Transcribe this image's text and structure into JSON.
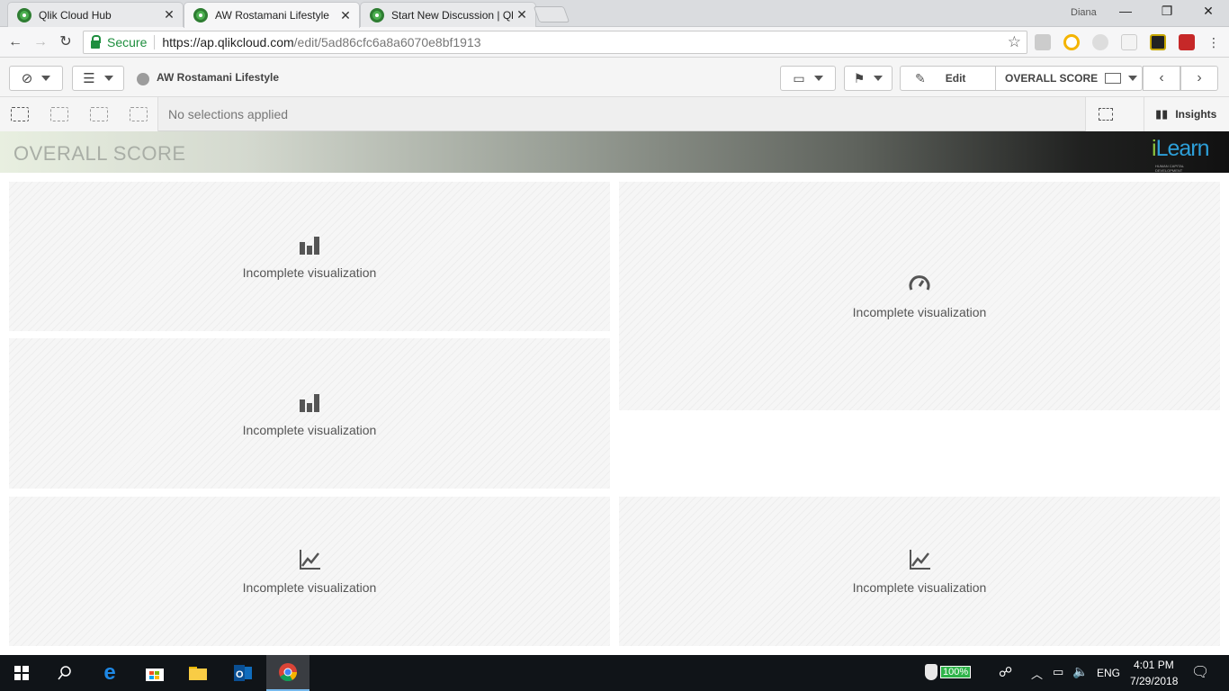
{
  "browser": {
    "tabs": [
      {
        "title": "Qlik Cloud Hub",
        "active": false
      },
      {
        "title": "AW Rostamani Lifestyle",
        "active": true
      },
      {
        "title": "Start New Discussion | Ql",
        "active": false
      }
    ],
    "user": "Diana",
    "secure_label": "Secure",
    "url_host": "https://ap.qlikcloud.com",
    "url_path": "/edit/5ad86cfc6a8a6070e8bf1913"
  },
  "toolbar": {
    "app_name": "AW Rostamani Lifestyle",
    "edit_label": "Edit",
    "sheet_name": "OVERALL SCORE"
  },
  "selections": {
    "status": "No selections applied",
    "insights_label": "Insights"
  },
  "sheet": {
    "title": "OVERALL SCORE",
    "logo_text": "Learn",
    "logo_prefix": "i",
    "logo_subtitle": "HUMAN CAPITAL DEVELOPMENT"
  },
  "tiles": [
    {
      "icon": "bar-chart-icon",
      "label": "Incomplete visualization"
    },
    {
      "icon": "gauge-icon",
      "label": "Incomplete visualization"
    },
    {
      "icon": "bar-chart-icon",
      "label": "Incomplete visualization"
    },
    {
      "icon": "line-chart-icon",
      "label": "Incomplete visualization"
    },
    {
      "icon": "line-chart-icon",
      "label": "Incomplete visualization"
    }
  ],
  "taskbar": {
    "battery": "100%",
    "language": "ENG",
    "time": "4:01 PM",
    "date": "7/29/2018"
  }
}
